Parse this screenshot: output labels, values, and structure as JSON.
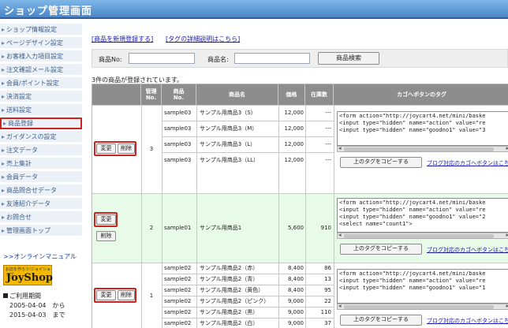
{
  "header": {
    "title": "ショップ管理画面"
  },
  "sidebar": {
    "items": [
      {
        "label": "ショップ情報設定"
      },
      {
        "label": "ページデザイン設定"
      },
      {
        "label": "お客様入力項目設定"
      },
      {
        "label": "注文確認メール設定"
      },
      {
        "label": "会員/ポイント設定"
      },
      {
        "label": "決済設定"
      },
      {
        "label": "送料設定"
      },
      {
        "label": "商品登録",
        "active": true
      },
      {
        "label": "ガイダンスの設定"
      },
      {
        "label": "注文データ"
      },
      {
        "label": "売上集計"
      },
      {
        "label": "会員データ"
      },
      {
        "label": "商品問合せデータ"
      },
      {
        "label": "友達紹介データ"
      },
      {
        "label": "お問合せ"
      },
      {
        "label": "管理画面トップ"
      }
    ],
    "manual_link": ">>オンラインマニュアル",
    "logo": {
      "sub": "お店を作ろう!ジョイショップ",
      "brand": "JoyShop"
    },
    "period": {
      "label": "ご利用期間",
      "from": "2005-04-04　から",
      "to": "2015-04-03　まで"
    }
  },
  "main": {
    "links": {
      "new_product": "[商品を新規登録する]",
      "tag_detail": "[タグの詳細説明はこちら]"
    },
    "search": {
      "product_no_label": "商品No:",
      "product_name_label": "商品名:",
      "button": "商品検索"
    },
    "count_text": "3件の商品が登録されています。",
    "table": {
      "headers": [
        "",
        "管理\nNo.",
        "商品\nNo.",
        "商品名",
        "価格",
        "在庫数",
        "カゴへボタンのタグ"
      ],
      "edit_label": "変更",
      "delete_label": "削除",
      "copy_label": "上のタグをコピーする",
      "blog_label": "ブログ対応のカゴへボタンはこちら",
      "groups": [
        {
          "mgmt_no": "3",
          "rows": [
            {
              "no": "sample03",
              "name": "サンプル用商品3（S）",
              "price": "12,000",
              "stock": "---"
            },
            {
              "no": "sample03",
              "name": "サンプル用商品3（M）",
              "price": "12,000",
              "stock": "---"
            },
            {
              "no": "sample03",
              "name": "サンプル用商品3（L）",
              "price": "12,000",
              "stock": "---"
            },
            {
              "no": "sample03",
              "name": "サンプル用商品3（LL）",
              "price": "12,000",
              "stock": "---"
            }
          ],
          "code": "<form action=\"http://joycart4.net/mini/baske\n<input type=\"hidden\" name=\"action\" value=\"re\n<input type=\"hidden\" name=\"goodno1\" value=\"3"
        },
        {
          "mgmt_no": "2",
          "rows": [
            {
              "no": "sample01",
              "name": "サンプル用商品1",
              "price": "5,600",
              "stock": "910"
            }
          ],
          "code": "<form action=\"http://joycart4.net/mini/baske\n<input type=\"hidden\" name=\"action\" value=\"re\n<input type=\"hidden\" name=\"goodno1\" value=\"2\n<select name=\"count1\">"
        },
        {
          "mgmt_no": "1",
          "rows": [
            {
              "no": "sample02",
              "name": "サンプル用商品2（赤）",
              "price": "8,400",
              "stock": "86"
            },
            {
              "no": "sample02",
              "name": "サンプル用商品2（青）",
              "price": "8,400",
              "stock": "13"
            },
            {
              "no": "sample02",
              "name": "サンプル用商品2（黄色）",
              "price": "8,400",
              "stock": "95"
            },
            {
              "no": "sample02",
              "name": "サンプル用商品2（ピンク）",
              "price": "9,000",
              "stock": "22"
            },
            {
              "no": "sample02",
              "name": "サンプル用商品2（黒）",
              "price": "9,000",
              "stock": "110"
            },
            {
              "no": "sample02",
              "name": "サンプル用商品2（白）",
              "price": "9,000",
              "stock": "37"
            }
          ],
          "code": "<form action=\"http://joycart4.net/mini/baske\n<input type=\"hidden\" name=\"action\" value=\"re\n<input type=\"hidden\" name=\"goodno1\" value=\"1"
        }
      ]
    }
  }
}
